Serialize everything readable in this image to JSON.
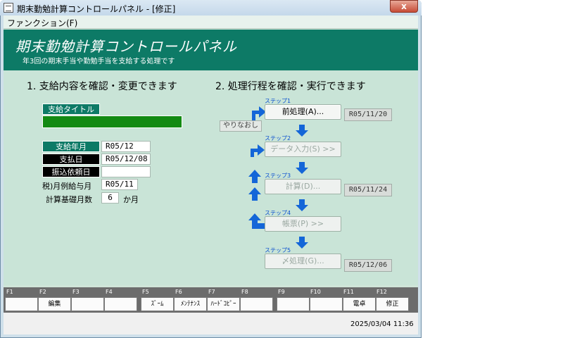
{
  "window": {
    "title": "期末勤勉計算コントロールパネル - [修正]",
    "close": "x"
  },
  "menu": {
    "function": "ファンクション(F)"
  },
  "banner": {
    "title": "期末勤勉計算コントロールパネル",
    "subtitle": "年3回の期末手当や勤勉手当を支給する処理です"
  },
  "left": {
    "heading": "1. 支給内容を確認・変更できます",
    "title_label": "支給タイトル",
    "title_value": "",
    "pay_month_label": "支給年月",
    "pay_month_value": "R05/12",
    "payment_day_label": "支払日",
    "payment_day_value": "R05/12/08",
    "transfer_label": "振込依頼日",
    "transfer_value": "",
    "tax_month_label": "税)月例給与月",
    "tax_month_value": "R05/11",
    "basis_label": "計算基礎月数",
    "basis_value": "6",
    "basis_unit": "か月"
  },
  "right": {
    "heading": "2. 処理行程を確認・実行できます",
    "redo": "やりなおし",
    "steps": [
      {
        "label": "ステップ1",
        "button": "前処理(A)...",
        "date": "R05/11/20"
      },
      {
        "label": "ステップ2",
        "button": "データ入力(S) >>",
        "date": ""
      },
      {
        "label": "ステップ3",
        "button": "計算(D)...",
        "date": "R05/11/24"
      },
      {
        "label": "ステップ4",
        "button": "帳票(P) >>",
        "date": ""
      },
      {
        "label": "ステップ5",
        "button": "〆処理(G)...",
        "date": "R05/12/06"
      }
    ]
  },
  "fkeys": [
    {
      "num": "F1",
      "label": ""
    },
    {
      "num": "F2",
      "label": "編集"
    },
    {
      "num": "F3",
      "label": ""
    },
    {
      "num": "F4",
      "label": ""
    },
    {
      "num": "F5",
      "label": "ｽﾞｰﾑ"
    },
    {
      "num": "F6",
      "label": "ﾒﾝﾃﾅﾝｽ"
    },
    {
      "num": "F7",
      "label": "ﾊｰﾄﾞｺﾋﾟｰ"
    },
    {
      "num": "F8",
      "label": ""
    },
    {
      "num": "F9",
      "label": ""
    },
    {
      "num": "F10",
      "label": ""
    },
    {
      "num": "F11",
      "label": "電卓"
    },
    {
      "num": "F12",
      "label": "修正"
    }
  ],
  "status": {
    "datetime": "2025/03/04  11:36"
  },
  "colors": {
    "accent": "#0d7a66",
    "progress_green": "#138a13",
    "arrow_blue": "#1466d8"
  }
}
